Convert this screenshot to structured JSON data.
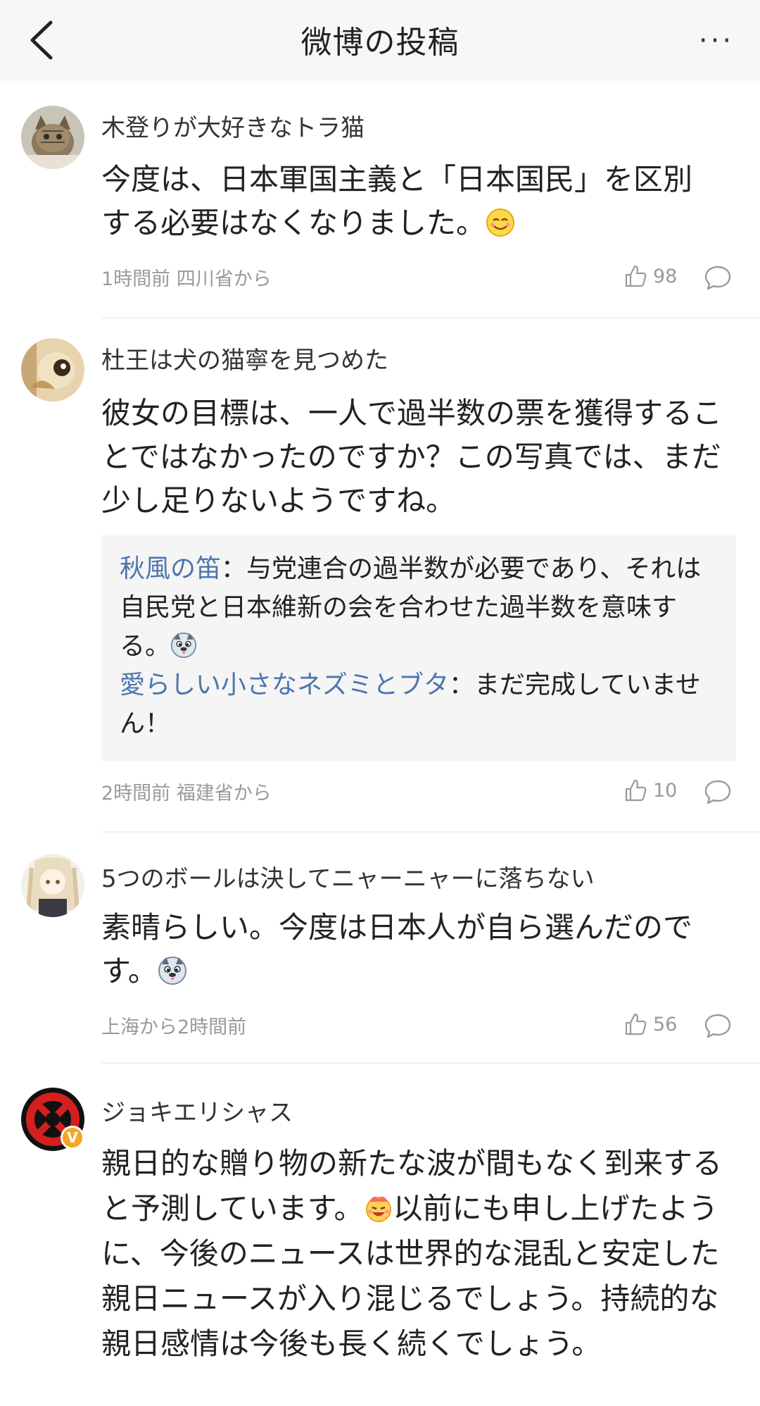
{
  "header": {
    "title": "微博の投稿",
    "back_icon": "chevron-left-icon",
    "more_icon": "more-horizontal-icon",
    "more_label": "···"
  },
  "comments": [
    {
      "username": "木登りが大好きなトラ猫",
      "text_line1": "今度は、日本軍国主義と「日本国民」を区別",
      "text_line2": "する必要はなくなりました。",
      "emoji": "smiling-face-emoji",
      "meta": "1時間前 四川省から",
      "likes": "98"
    },
    {
      "username": "杜王は犬の猫寧を見つめた",
      "text": "彼女の目標は、一人で過半数の票を獲得することではなかったのですか？この写真では、まだ少し足りないようですね。",
      "replies": [
        {
          "name": "秋風の笛",
          "sep": "：",
          "text": "与党連合の過半数が必要であり、それは自民党と日本維新の会を合わせた過半数を意味する。",
          "emoji": "doge-emoji"
        },
        {
          "name": "愛らしい小さなネズミとブタ",
          "sep": "：",
          "text": "まだ完成していません！"
        }
      ],
      "meta": "2時間前 福建省から",
      "likes": "10"
    },
    {
      "username": "5つのボールは決してニャーニャーに落ちない",
      "text_line1": "素晴らしい。今度は日本人が自ら選んだので",
      "text_line2": "す。",
      "emoji": "doge-emoji",
      "meta": "上海から2時間前",
      "likes": "56"
    },
    {
      "username": "ジョキエリシャス",
      "verified_badge": "V",
      "text_part1": "親日的な贈り物の新たな波が間もなく到来すると予測しています。",
      "emoji": "laughing-emoji",
      "text_part2": "以前にも申し上げたように、今後のニュースは世界的な混乱と安定した親日ニュースが入り混じるでしょう。持続的な親日感情は今後も長く続くでしょう。"
    }
  ],
  "colors": {
    "accent_link": "#4d76ad",
    "meta_gray": "#9a9a9a",
    "header_bg": "#f7f7f7",
    "reply_bg": "#f5f5f5",
    "badge": "#f5a623"
  }
}
